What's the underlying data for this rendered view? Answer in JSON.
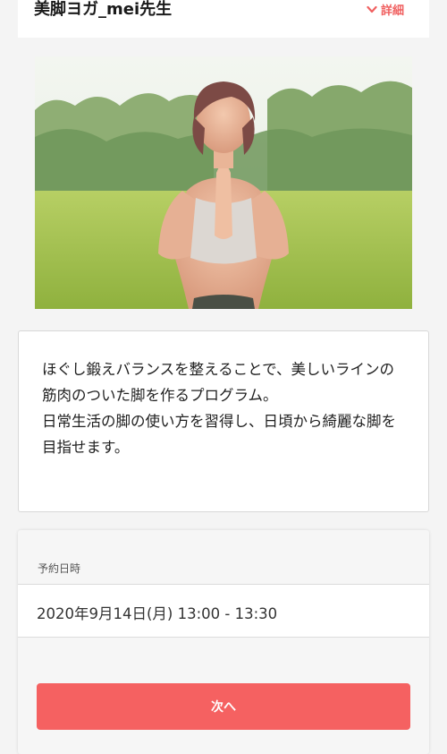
{
  "header": {
    "instructor_name": "美脚ヨガ_mei先生",
    "details_label": "詳細",
    "accent_color": "#f06060"
  },
  "photo": {
    "icon": "instructor-photo"
  },
  "description": {
    "text": "ほぐし鍛えバランスを整えることで、美しいラインの筋肉のついた脚を作るプログラム。\n日常生活の脚の使い方を習得し、日頃から綺麗な脚を目指せます。"
  },
  "booking": {
    "date_label": "予約日時",
    "date_value": "2020年9月14日(月)  13:00 - 13:30",
    "next_label": "次へ",
    "button_color": "#f56161"
  }
}
